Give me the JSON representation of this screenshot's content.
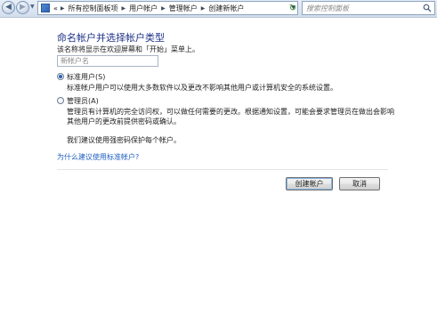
{
  "nav": {
    "back_glyph": "◀",
    "forward_glyph": "▶",
    "recent_glyph": "▼",
    "breadcrumbs": [
      "«",
      "所有控制面板项",
      "用户帐户",
      "管理帐户",
      "创建新帐户"
    ],
    "separator": "▶",
    "dropdown_glyph": "▼",
    "refresh_glyph": "↻",
    "search_placeholder": "搜索控制面板"
  },
  "main": {
    "heading": "命名帐户并选择帐户类型",
    "subtitle": "该名称将显示在欢迎屏幕和「开始」菜单上。",
    "name_placeholder": "新帐户名",
    "standard": {
      "label": "标准用户(S)",
      "description": "标准帐户用户可以使用大多数软件以及更改不影响其他用户或计算机安全的系统设置。",
      "selected": true
    },
    "admin": {
      "label": "管理员(A)",
      "description_line1": "管理员有计算机的完全访问权，可以做任何需要的更改。根据通知设置，可能会要求管理员在做出会影响",
      "description_line2": "其他用户的更改前提供密码或确认。",
      "selected": false
    },
    "recommend": "我们建议使用强密码保护每个帐户。",
    "why_link": "为什么建议使用标准帐户?"
  },
  "buttons": {
    "create": "创建帐户",
    "cancel": "取消"
  },
  "colors": {
    "heading": "#1e3287",
    "link": "#1f5fbf",
    "navbar": "#d3deec"
  }
}
